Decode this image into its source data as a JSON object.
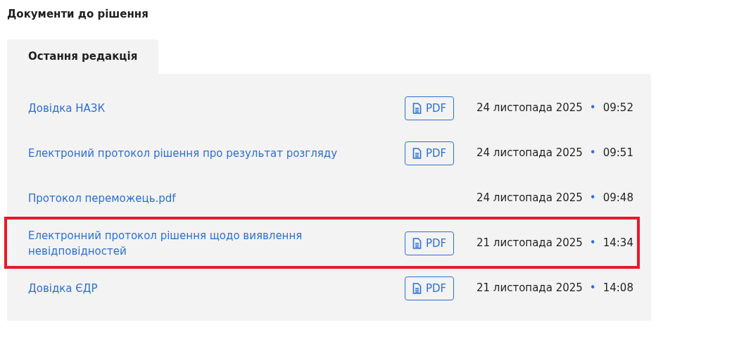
{
  "title": "Документи до рішення",
  "tabs": [
    {
      "label": "Остання редакція",
      "selected": true
    }
  ],
  "documents": [
    {
      "name": "Довідка НАЗК",
      "pdf_label": "PDF",
      "date": "24 листопада 2025",
      "separator": "•",
      "time": "09:52",
      "highlighted": false
    },
    {
      "name": "Електроний протокол рішення про результат розгляду",
      "pdf_label": "PDF",
      "date": "24 листопада 2025",
      "separator": "•",
      "time": "09:51",
      "highlighted": false
    },
    {
      "name": "Протокол переможець.pdf",
      "date": "24 листопада 2025",
      "separator": "•",
      "time": "09:48",
      "highlighted": false
    },
    {
      "name": "Електронний протокол рішення щодо виявлення невідповідностей",
      "pdf_label": "PDF",
      "date": "21 листопада 2025",
      "separator": "•",
      "time": "14:34",
      "highlighted": true
    },
    {
      "name": "Довідка ЄДР",
      "pdf_label": "PDF",
      "date": "21 листопада 2025",
      "separator": "•",
      "time": "14:08",
      "highlighted": false
    }
  ]
}
